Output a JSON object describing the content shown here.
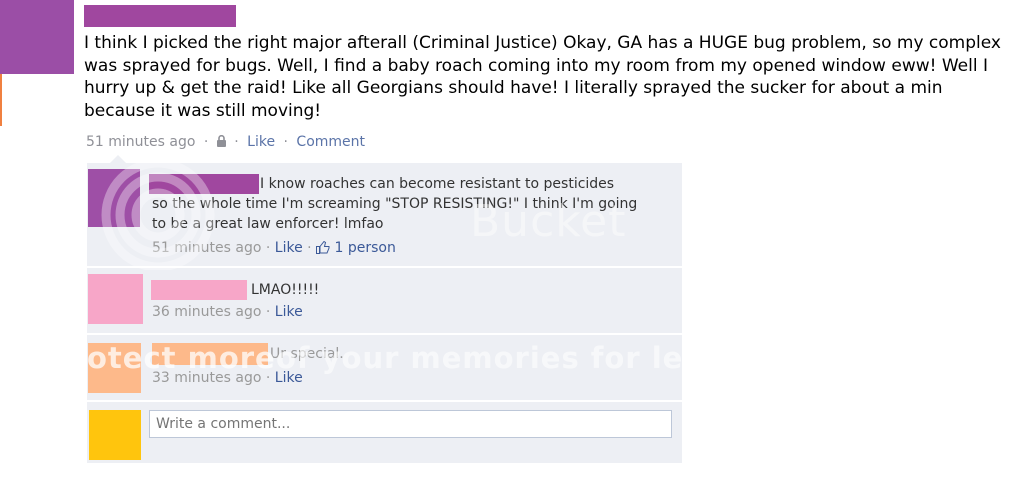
{
  "post": {
    "text": "I think I picked the right major afterall (Criminal Justice) Okay, GA has a HUGE bug problem, so my complex was sprayed for bugs. Well, I find a baby roach coming into my room from my opened window eww! Well I hurry up & get the raid! Like all Georgians should have! I literally sprayed the sucker for about a min because it was still moving!",
    "timestamp": "51 minutes ago",
    "like_label": "Like",
    "comment_label": "Comment"
  },
  "comments": [
    {
      "text_line1": "I know roaches can become resistant to pesticides",
      "text_rest": "so the whole time I'm screaming \"STOP RESISTING!\" I think I'm going to be a great law enforcer! lmfao",
      "timestamp": "51 minutes ago",
      "like_label": "Like",
      "likes": "1 person"
    },
    {
      "text": "LMAO!!!!!",
      "timestamp": "36 minutes ago",
      "like_label": "Like"
    },
    {
      "text": "Ur special.",
      "timestamp": "33 minutes ago",
      "like_label": "Like"
    }
  ],
  "composer": {
    "placeholder": "Write a comment..."
  },
  "watermark": {
    "brand": "Bucket",
    "tagline_a": "otect more",
    "tagline_b": "of your memories for less!"
  },
  "colors": {
    "link": "#3b5998",
    "comment_bg": "#edeff4",
    "redact_purple": "#a0479f",
    "redact_pink": "#f7a6c8",
    "redact_peach": "#fdb98a",
    "avatar_yellow": "#ffc50d"
  }
}
